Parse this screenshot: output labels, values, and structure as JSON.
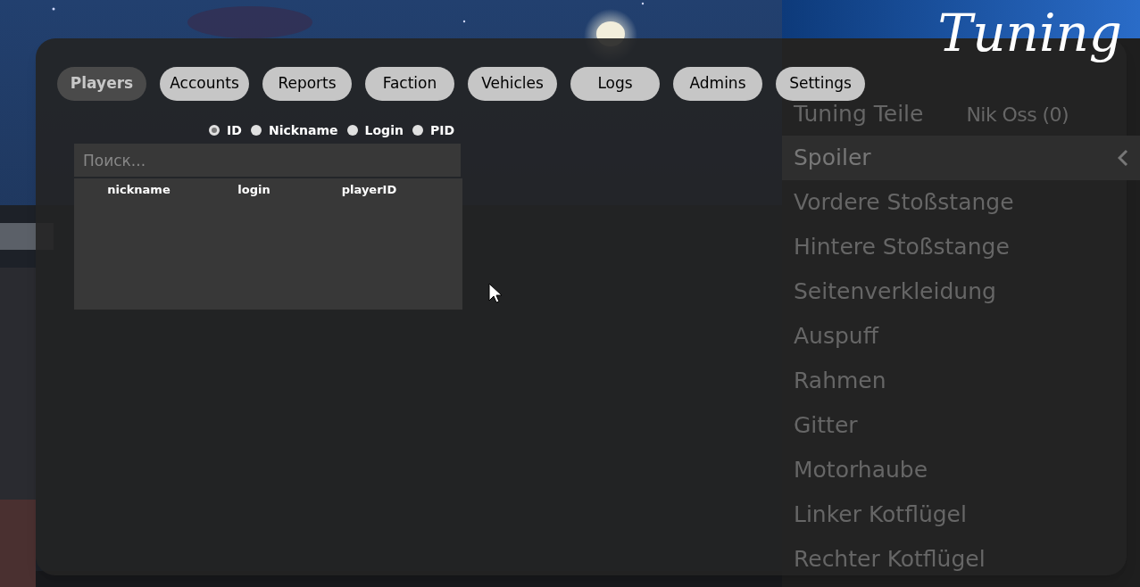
{
  "tuning_menu": {
    "title": "Tuning",
    "header": {
      "label": "Tuning Teile",
      "player": "Nik Oss (0)"
    },
    "items": [
      {
        "label": "Spoiler",
        "selected": true
      },
      {
        "label": "Vordere Stoßstange",
        "selected": false
      },
      {
        "label": "Hintere Stoßstange",
        "selected": false
      },
      {
        "label": "Seitenverkleidung",
        "selected": false
      },
      {
        "label": "Auspuff",
        "selected": false
      },
      {
        "label": "Rahmen",
        "selected": false
      },
      {
        "label": "Gitter",
        "selected": false
      },
      {
        "label": "Motorhaube",
        "selected": false
      },
      {
        "label": "Linker Kotflügel",
        "selected": false
      },
      {
        "label": "Rechter Kotflügel",
        "selected": false
      }
    ]
  },
  "admin_panel": {
    "tabs": [
      {
        "label": "Players",
        "selected": true
      },
      {
        "label": "Accounts",
        "selected": false
      },
      {
        "label": "Reports",
        "selected": false
      },
      {
        "label": "Faction",
        "selected": false
      },
      {
        "label": "Vehicles",
        "selected": false
      },
      {
        "label": "Logs",
        "selected": false
      },
      {
        "label": "Admins",
        "selected": false
      },
      {
        "label": "Settings",
        "selected": false
      }
    ],
    "search_by": [
      {
        "label": "ID",
        "selected": true
      },
      {
        "label": "Nickname",
        "selected": false
      },
      {
        "label": "Login",
        "selected": false
      },
      {
        "label": "PID",
        "selected": false
      }
    ],
    "search": {
      "placeholder": "Поиск..."
    },
    "table": {
      "columns": [
        "nickname",
        "login",
        "playerID"
      ]
    }
  }
}
